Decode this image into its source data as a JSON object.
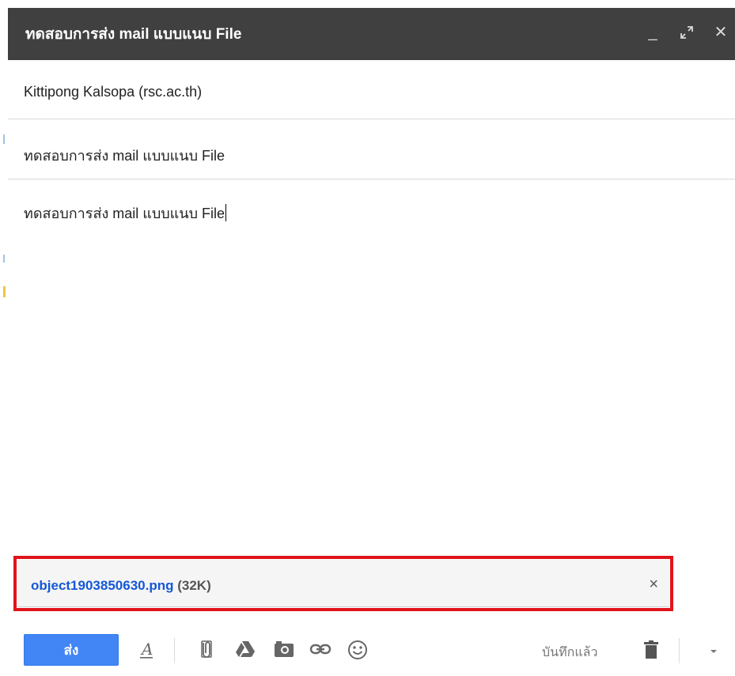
{
  "compose": {
    "title": "ทดสอบการส่ง mail แบบแนบ File",
    "window_controls": {
      "minimize": "_",
      "expand": "⤢",
      "close": "✕"
    },
    "recipients": "Kittipong Kalsopa (rsc.ac.th)",
    "subject": "ทดสอบการส่ง mail แบบแนบ File",
    "body": "ทดสอบการส่ง mail แบบแนบ File"
  },
  "attachment": {
    "filename": "object1903850630.png",
    "size": "(32K)",
    "remove": "×"
  },
  "toolbar": {
    "send_label": "ส่ง",
    "saved_status": "บันทึกแล้ว",
    "icons": [
      "formatting-icon",
      "attach-file-icon",
      "google-drive-icon",
      "insert-photo-icon",
      "insert-link-icon",
      "emoji-icon",
      "discard-draft-icon",
      "more-options-icon"
    ]
  },
  "colors": {
    "titlebar": "#404040",
    "send_button": "#4285f4",
    "attachment_link": "#1558d6",
    "highlight_box": "#e0141a"
  }
}
